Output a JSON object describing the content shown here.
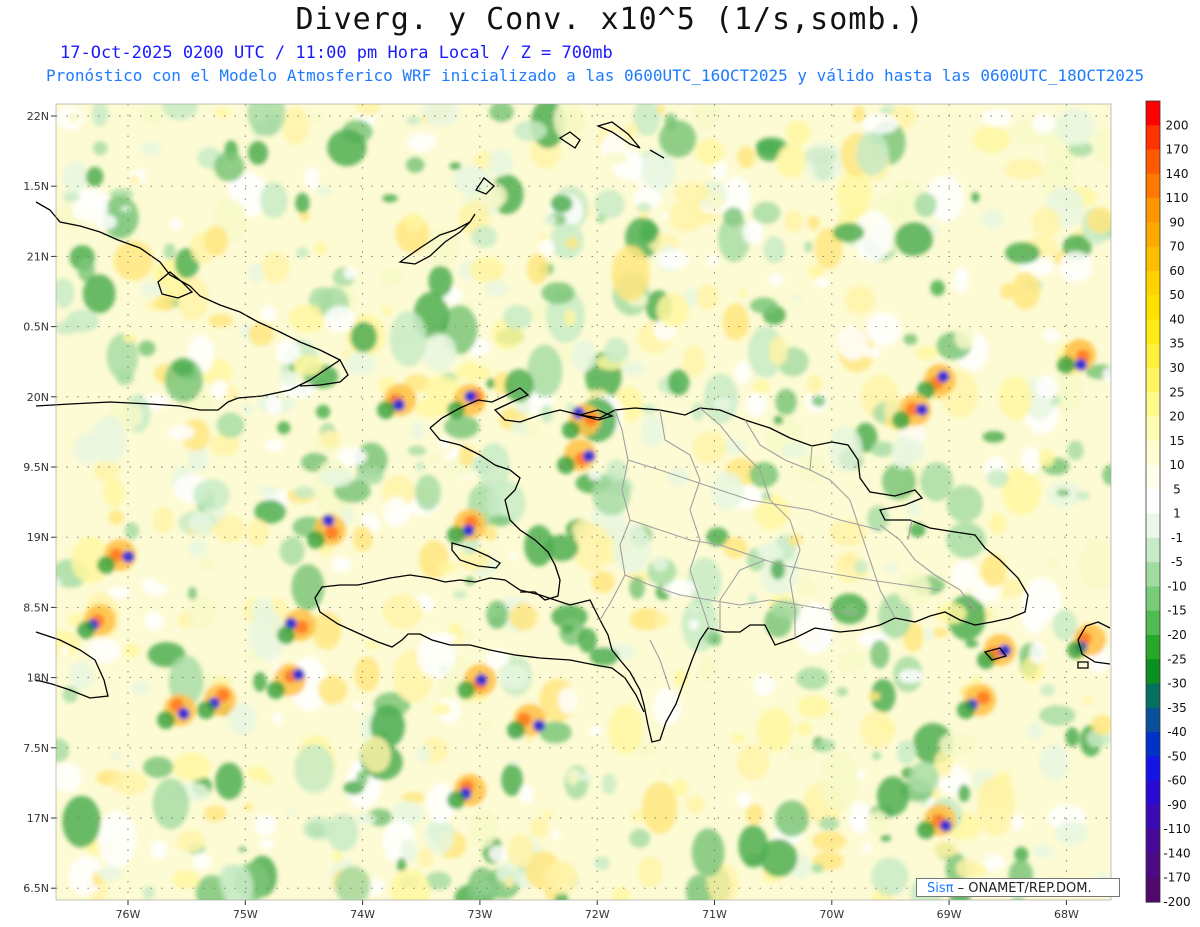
{
  "header": {
    "title": "Diverg. y Conv. x10^5 (1/s,somb.)",
    "valid_line": "17-Oct-2025  0200 UTC / 11:00 pm Hora Local / Z = 700mb",
    "forecast_line": "Pronóstico con el Modelo Atmosferico WRF inicializado a las 0600UTC_16OCT2025 y válido hasta las  0600UTC_18OCT2025"
  },
  "map": {
    "lat_labels": [
      "22N",
      "1.5N",
      "21N",
      "0.5N",
      "20N",
      "9.5N",
      "19N",
      "8.5N",
      "18N",
      "7.5N",
      "17N",
      "6.5N"
    ],
    "lon_labels": [
      "76W",
      "75W",
      "74W",
      "73W",
      "72W",
      "71W",
      "70W",
      "69W",
      "68W"
    ],
    "colors": {
      "land_outline": "#000000",
      "provinces": "#a0a0a0",
      "grid": "#777777"
    }
  },
  "colorbar": {
    "labels": [
      "200",
      "170",
      "140",
      "110",
      "90",
      "70",
      "60",
      "50",
      "40",
      "35",
      "30",
      "25",
      "20",
      "15",
      "10",
      "5",
      "1",
      "-1",
      "-5",
      "-10",
      "-15",
      "-20",
      "-25",
      "-30",
      "-35",
      "-40",
      "-50",
      "-60",
      "-90",
      "-110",
      "-140",
      "-170",
      "-200"
    ],
    "colors": [
      "#ff0000",
      "#ff3200",
      "#ff5a00",
      "#ff7800",
      "#ff9600",
      "#ffaa00",
      "#ffbe00",
      "#ffd200",
      "#ffe100",
      "#ffeb14",
      "#fff03c",
      "#fff564",
      "#fffa8c",
      "#fffcb4",
      "#fffed2",
      "#ffffeb",
      "#ffffff",
      "#eaf7ea",
      "#c6ebc6",
      "#a0dca0",
      "#78cc78",
      "#50bb50",
      "#28a828",
      "#0b8f1e",
      "#067060",
      "#0a4f9a",
      "#0032c8",
      "#1414e6",
      "#2a0ad2",
      "#3c0ab4",
      "#460a96",
      "#4b0a82",
      "#50086e"
    ]
  },
  "credit": {
    "brand": "Sisπ",
    "text": " – ONAMET/REP.DOM."
  }
}
